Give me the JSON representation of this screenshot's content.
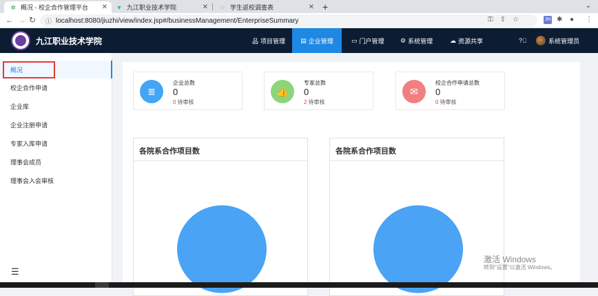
{
  "browser": {
    "tabs": [
      {
        "title": "概况 - 校企合作管理平台",
        "active": true
      },
      {
        "title": "九江职业技术学院",
        "active": false
      },
      {
        "title": "学生返校调查表",
        "active": false
      }
    ],
    "url": "localhost:8080/jiuzhi/view/index.jsp#/businessManagement/EnterpriseSummary",
    "extension_badge": "JH"
  },
  "header": {
    "brand": "九江职业技术学院",
    "nav": [
      {
        "label": "项目管理",
        "icon": "sitemap-icon"
      },
      {
        "label": "企业管理",
        "icon": "building-icon",
        "active": true
      },
      {
        "label": "门户管理",
        "icon": "monitor-icon"
      },
      {
        "label": "系统管理",
        "icon": "gear-icon"
      },
      {
        "label": "资源共享",
        "icon": "cloud-icon"
      }
    ],
    "help_icon": "question-icon",
    "user": "系统管理员"
  },
  "sidebar": {
    "items": [
      {
        "label": "概况",
        "active": true
      },
      {
        "label": "校企合作申请"
      },
      {
        "label": "企业库"
      },
      {
        "label": "企业注册申请"
      },
      {
        "label": "专家入库申请"
      },
      {
        "label": "理事会成员"
      },
      {
        "label": "理事会入会审核"
      }
    ]
  },
  "stats": [
    {
      "label": "企业总数",
      "value": "0",
      "pending_num": "0",
      "pending_label": "待审核",
      "color": "#42a5f5",
      "icon": "database-icon"
    },
    {
      "label": "专家总数",
      "value": "0",
      "pending_num": "2",
      "pending_label": "待审核",
      "color": "#8bd67a",
      "icon": "thumbs-up-icon"
    },
    {
      "label": "校企合作申请总数",
      "value": "0",
      "pending_num": "0",
      "pending_label": "待审核",
      "color": "#f08080",
      "icon": "inbox-icon"
    }
  ],
  "charts": [
    {
      "title": "各院系合作项目数"
    },
    {
      "title": "各院系合作项目数"
    }
  ],
  "chart_data": [
    {
      "type": "pie",
      "title": "各院系合作项目数",
      "labels": [
        ""
      ],
      "values": [
        1
      ],
      "colors": [
        "#4aa3f5"
      ]
    },
    {
      "type": "pie",
      "title": "各院系合作项目数",
      "labels": [
        ""
      ],
      "values": [
        1
      ],
      "colors": [
        "#4aa3f5"
      ]
    }
  ],
  "watermark": {
    "line1": "激活 Windows",
    "line2": "转到\"设置\"以激活 Windows。"
  }
}
